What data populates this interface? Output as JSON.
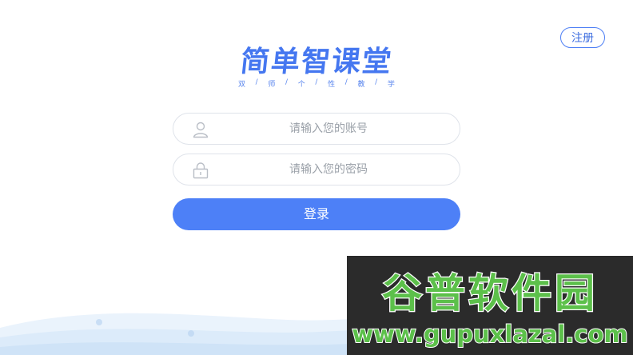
{
  "header": {
    "register_label": "注册"
  },
  "logo": {
    "title": "简单智课堂",
    "subtitle": [
      "双",
      "/",
      "师",
      "/",
      "个",
      "/",
      "性",
      "/",
      "教",
      "/",
      "学"
    ]
  },
  "form": {
    "account_placeholder": "请输入您的账号",
    "password_placeholder": "请输入您的密码",
    "login_label": "登录"
  },
  "watermark": {
    "brand": "谷普软件园",
    "url": "www.gupuxlazal.com"
  },
  "colors": {
    "primary": "#4d80f7",
    "logo": "#4577f0",
    "border": "#dfe3ea",
    "placeholder": "#9aa0a8",
    "watermark_bg": "#2b2b2b",
    "watermark_green": "#5cc04a"
  }
}
